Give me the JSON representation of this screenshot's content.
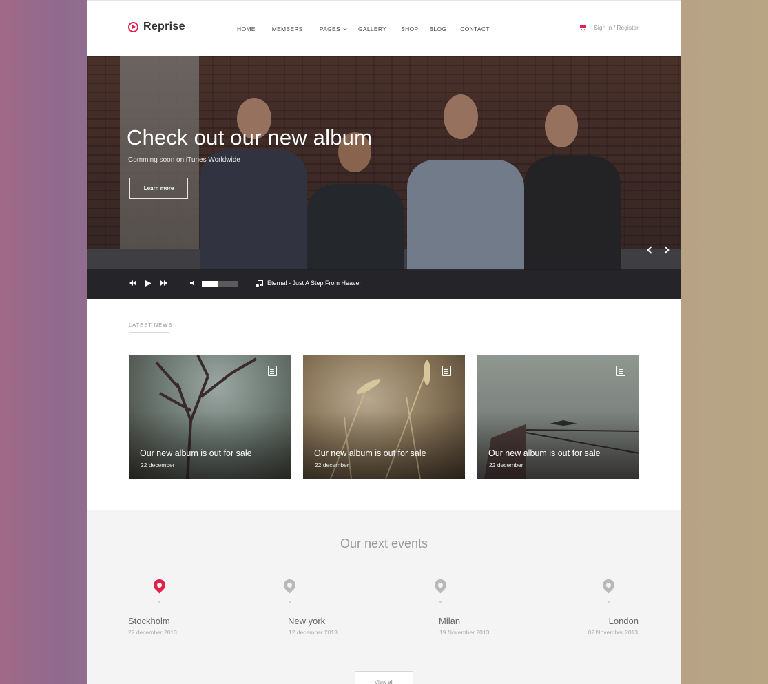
{
  "brand": {
    "name": "Reprise",
    "accent_color": "#e0224c"
  },
  "nav": {
    "items": [
      {
        "label": "HOME"
      },
      {
        "label": "MEMBERS"
      },
      {
        "label": "PAGES",
        "has_dropdown": true
      },
      {
        "label": "GALLERY"
      },
      {
        "label": "SHOP"
      },
      {
        "label": "BLOG"
      },
      {
        "label": "CONTACT"
      }
    ]
  },
  "account": {
    "auth_label": "Sign in / Register",
    "cart_icon": "cart-icon"
  },
  "hero": {
    "title": "Check out our new album",
    "subtitle": "Comming soon on iTunes Worldwide",
    "button_label": "Learn more",
    "prev_icon": "chevron-left-icon",
    "next_icon": "chevron-right-icon"
  },
  "player": {
    "track": "Eternal - Just A Step From Heaven",
    "volume": 0.45
  },
  "news": {
    "label": "LATEST NEWS",
    "cards": [
      {
        "title": "Our new album is out for sale",
        "date": "22 december"
      },
      {
        "title": "Our new album is out for sale",
        "date": "22 december"
      },
      {
        "title": "Our new album is out for sale",
        "date": "22 december"
      }
    ]
  },
  "events": {
    "title": "Our next events",
    "items": [
      {
        "city": "Stockholm",
        "date": "22 december 2013",
        "active": true
      },
      {
        "city": "New york",
        "date": "12 december 2013",
        "active": false
      },
      {
        "city": "Milan",
        "date": "19 November 2013",
        "active": false
      },
      {
        "city": "London",
        "date": "02 November 2013",
        "active": false
      }
    ],
    "view_all_label": "View all",
    "active_color": "#e0224c",
    "inactive_color": "#b9b9b9"
  }
}
